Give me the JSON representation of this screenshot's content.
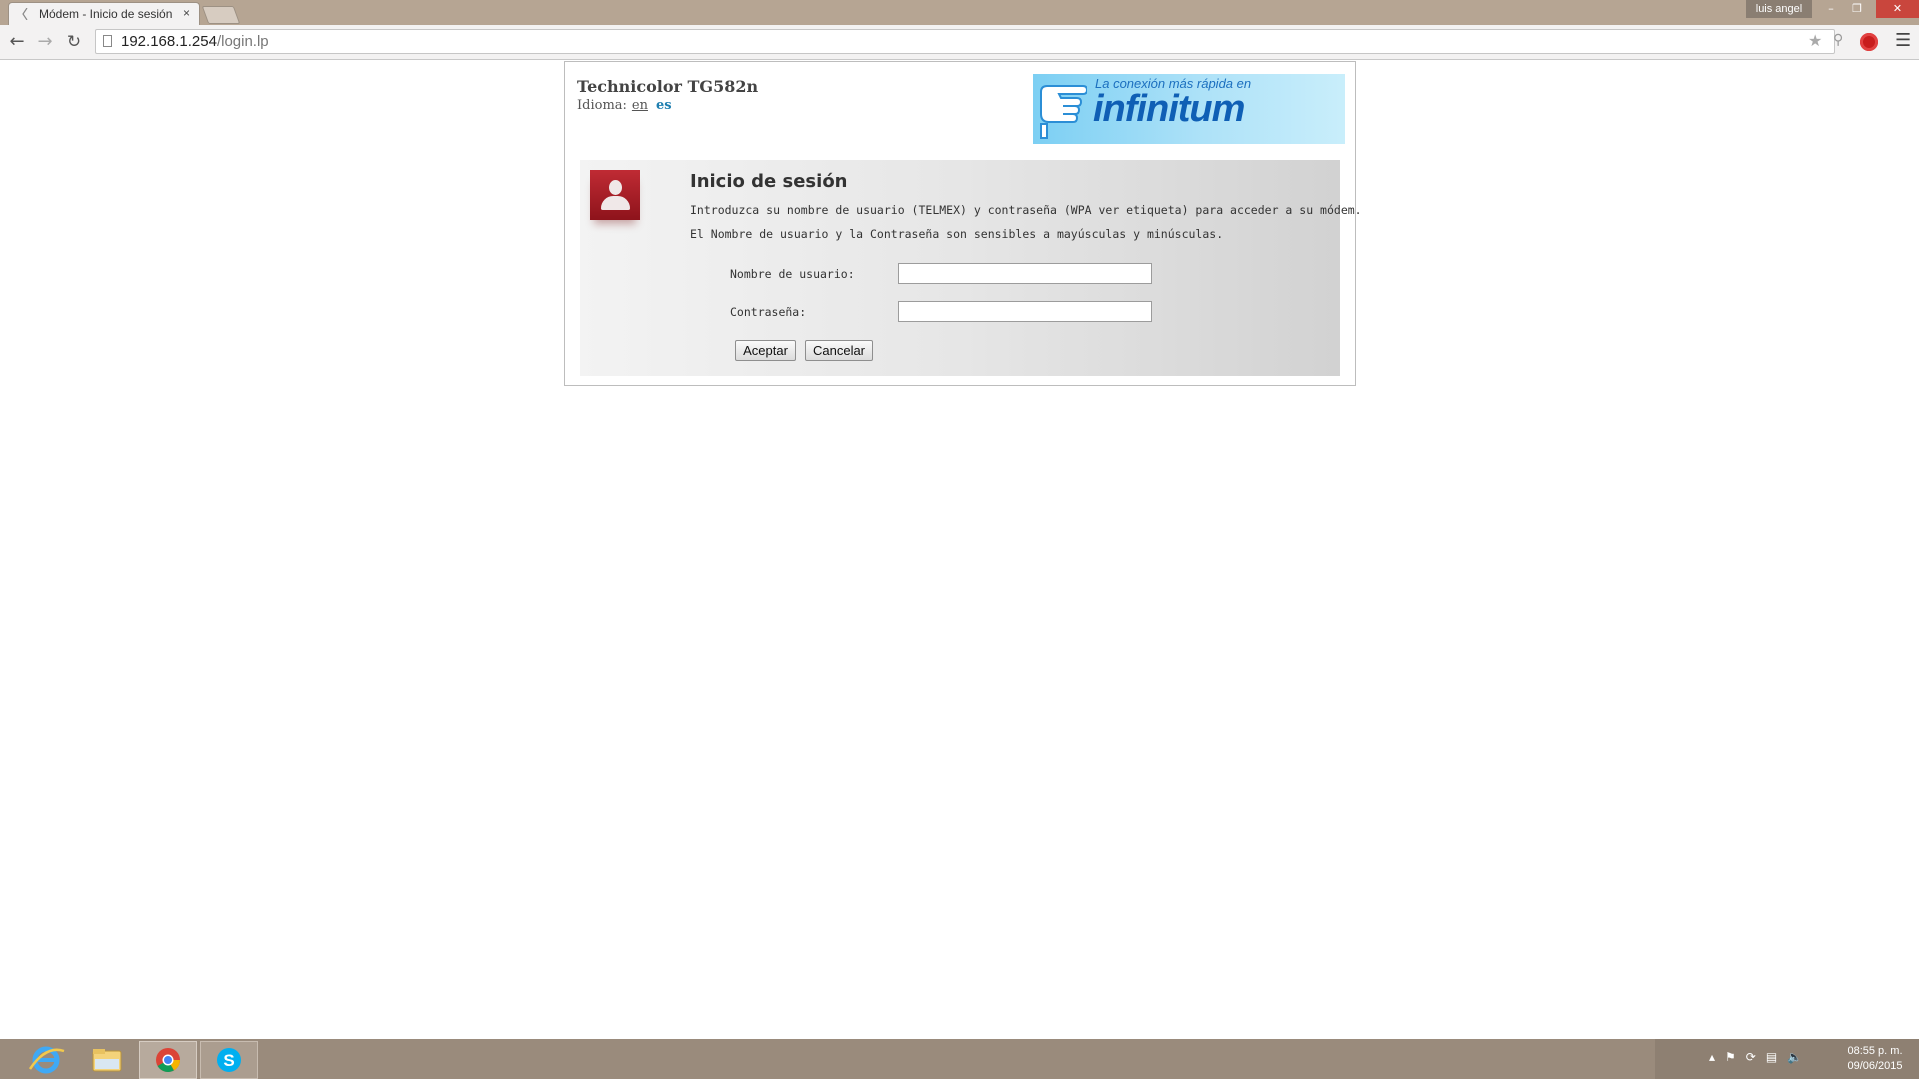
{
  "browser": {
    "tab_title": "Módem - Inicio de sesión",
    "tab_close": "×",
    "user_name": "luis angel",
    "url_host": "192.168.1.254",
    "url_path": "/login.lp"
  },
  "window_controls": {
    "minimize": "–",
    "restore": "❐",
    "close": "✕"
  },
  "header": {
    "model": "Technicolor TG582n",
    "language_label": "Idioma:",
    "lang_en": "en",
    "lang_es": "es"
  },
  "banner": {
    "tagline": "La conexión más rápida en",
    "brand": "infinitum"
  },
  "login": {
    "title": "Inicio de sesión",
    "text_line1": "Introduzca su nombre de usuario (TELMEX) y contraseña (WPA ver etiqueta) para acceder a su módem.",
    "text_line2": "El Nombre de usuario y la Contraseña son sensibles a mayúsculas y minúsculas.",
    "username_label": "Nombre de usuario:",
    "username_value": "",
    "password_label": "Contraseña:",
    "password_value": "",
    "accept_label": "Aceptar",
    "cancel_label": "Cancelar"
  },
  "taskbar": {
    "apps": [
      "internet-explorer-icon",
      "file-explorer-icon",
      "chrome-icon",
      "skype-icon"
    ],
    "clock_time": "08:55 p. m.",
    "clock_date": "09/06/2015"
  },
  "colors": {
    "titlebar": "#b6a593",
    "taskbar": "#9a8b7c",
    "accent_red": "#a3202a",
    "link_blue": "#1f7fb0"
  }
}
